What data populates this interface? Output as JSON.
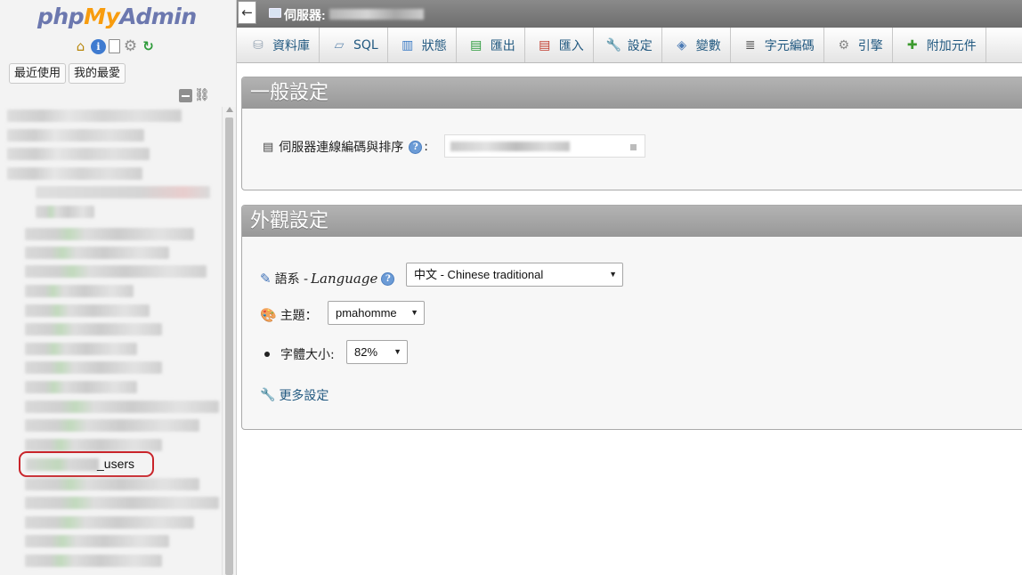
{
  "app": {
    "logo": {
      "php": "php",
      "my": "My",
      "admin": "Admin"
    },
    "nav_icons": [
      "home-icon",
      "info-icon",
      "docs-icon",
      "gear-icon",
      "reload-icon"
    ],
    "nav_tabs": {
      "recent": "最近使用",
      "favorites": "我的最愛"
    },
    "highlighted_item": "_users",
    "accent_colors": {
      "logo_blue": "#6c78af",
      "logo_orange": "#f89c0e",
      "highlight_red": "#c9242a",
      "link": "#235a81"
    }
  },
  "topbar": {
    "server_label": "伺服器:"
  },
  "menu": [
    {
      "label": "資料庫",
      "icon": "database-icon"
    },
    {
      "label": "SQL",
      "icon": "sql-icon"
    },
    {
      "label": "狀態",
      "icon": "status-icon"
    },
    {
      "label": "匯出",
      "icon": "export-icon"
    },
    {
      "label": "匯入",
      "icon": "import-icon"
    },
    {
      "label": "設定",
      "icon": "wrench-icon"
    },
    {
      "label": "變數",
      "icon": "variables-icon"
    },
    {
      "label": "字元編碼",
      "icon": "charset-icon"
    },
    {
      "label": "引擎",
      "icon": "engine-icon"
    },
    {
      "label": "附加元件",
      "icon": "plugin-icon"
    }
  ],
  "general": {
    "title": "一般設定",
    "collation_label": "伺服器連線編碼與排序",
    "colon": ":"
  },
  "appearance": {
    "title": "外觀設定",
    "language_label_cn": "語系 - ",
    "language_label_en": "Language",
    "language_value": "中文 - Chinese traditional",
    "theme_label": "主題：",
    "theme_value": "pmahomme",
    "font_size_label": "字體大小:",
    "font_size_value": "82%",
    "more_settings": "更多設定"
  }
}
